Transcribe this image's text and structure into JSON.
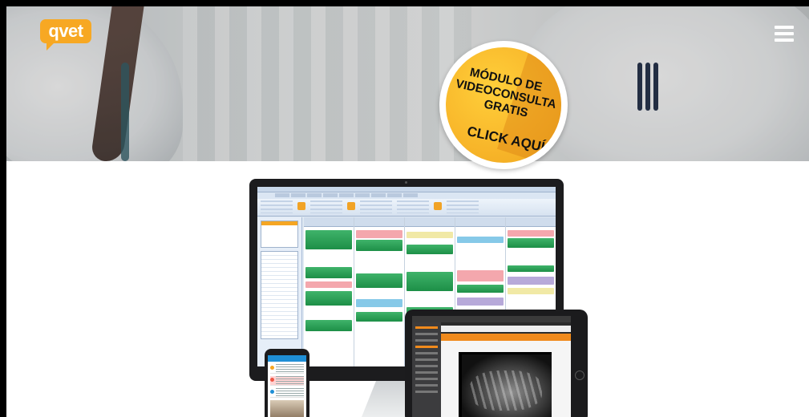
{
  "header": {
    "logo_text": "qvet",
    "menu_icon": "hamburger-icon"
  },
  "promo_badge": {
    "line1": "MÓDULO DE",
    "line2": "VIDEOCONSULTA",
    "line3": "GRATIS",
    "cta": "CLICK AQUÍ"
  },
  "colors": {
    "brand_orange": "#f7a823",
    "badge_yellow": "#f8b62a",
    "calendar_green": "#1d8f47"
  }
}
